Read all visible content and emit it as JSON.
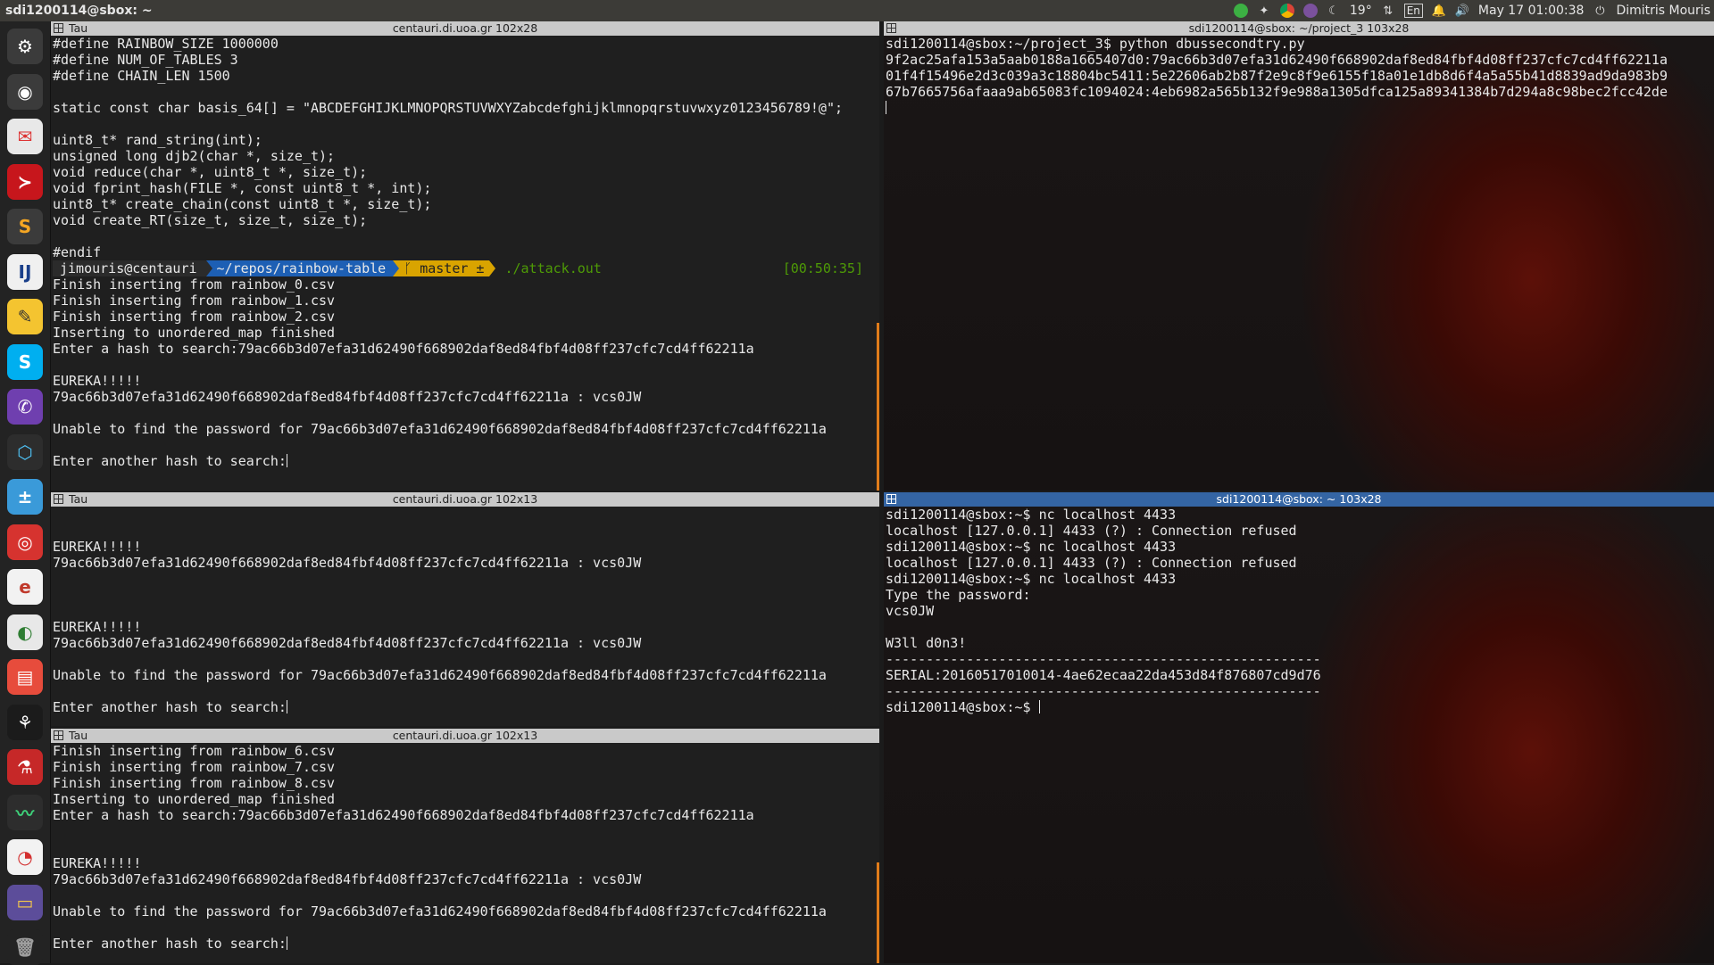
{
  "topbar": {
    "window_title": "sdi1200114@sbox: ~",
    "temperature": "19°",
    "keyboard_layout": "En",
    "datetime": "May 17 01:00:38",
    "user": "Dimitris Mouris"
  },
  "terminals": {
    "tl": {
      "app": "Tau",
      "title": "centauri.di.uoa.gr 102x28",
      "lines_top": [
        "#define RAINBOW_SIZE 1000000",
        "#define NUM_OF_TABLES 3",
        "#define CHAIN_LEN 1500",
        "",
        "static const char basis_64[] = \"ABCDEFGHIJKLMNOPQRSTUVWXYZabcdefghijklmnopqrstuvwxyz0123456789!@\";",
        "",
        "uint8_t* rand_string(int);",
        "unsigned long djb2(char *, size_t);",
        "void reduce(char *, uint8_t *, size_t);",
        "void fprint_hash(FILE *, const uint8_t *, int);",
        "uint8_t* create_chain(const uint8_t *, size_t);",
        "void create_RT(size_t, size_t, size_t);",
        "",
        "#endif"
      ],
      "prompt": {
        "user": "jimouris@centauri",
        "path": "~/repos/rainbow-table",
        "git": "ᚴ master ±",
        "command": "./attack.out",
        "time": "[00:50:35]"
      },
      "lines_bottom": [
        "Finish inserting from rainbow_0.csv",
        "Finish inserting from rainbow_1.csv",
        "Finish inserting from rainbow_2.csv",
        "Inserting to unordered_map finished",
        "Enter a hash to search:79ac66b3d07efa31d62490f668902daf8ed84fbf4d08ff237cfc7cd4ff62211a",
        "",
        "EUREKA!!!!!",
        "79ac66b3d07efa31d62490f668902daf8ed84fbf4d08ff237cfc7cd4ff62211a : vcs0JW",
        "",
        "Unable to find the password for 79ac66b3d07efa31d62490f668902daf8ed84fbf4d08ff237cfc7cd4ff62211a",
        "",
        "Enter another hash to search:"
      ]
    },
    "ml": {
      "app": "Tau",
      "title": "centauri.di.uoa.gr 102x13",
      "lines": [
        "",
        "",
        "EUREKA!!!!!",
        "79ac66b3d07efa31d62490f668902daf8ed84fbf4d08ff237cfc7cd4ff62211a : vcs0JW",
        "",
        "",
        "",
        "EUREKA!!!!!",
        "79ac66b3d07efa31d62490f668902daf8ed84fbf4d08ff237cfc7cd4ff62211a : vcs0JW",
        "",
        "Unable to find the password for 79ac66b3d07efa31d62490f668902daf8ed84fbf4d08ff237cfc7cd4ff62211a",
        "",
        "Enter another hash to search:"
      ]
    },
    "bl": {
      "app": "Tau",
      "title": "centauri.di.uoa.gr 102x13",
      "lines": [
        "Finish inserting from rainbow_6.csv",
        "Finish inserting from rainbow_7.csv",
        "Finish inserting from rainbow_8.csv",
        "Inserting to unordered_map finished",
        "Enter a hash to search:79ac66b3d07efa31d62490f668902daf8ed84fbf4d08ff237cfc7cd4ff62211a",
        "",
        "",
        "EUREKA!!!!!",
        "79ac66b3d07efa31d62490f668902daf8ed84fbf4d08ff237cfc7cd4ff62211a : vcs0JW",
        "",
        "Unable to find the password for 79ac66b3d07efa31d62490f668902daf8ed84fbf4d08ff237cfc7cd4ff62211a",
        "",
        "Enter another hash to search:"
      ]
    },
    "tr": {
      "title": "sdi1200114@sbox: ~/project_3 103x28",
      "lines": [
        "sdi1200114@sbox:~/project_3$ python dbussecondtry.py",
        "9f2ac25afa153a5aab0188a1665407d0:79ac66b3d07efa31d62490f668902daf8ed84fbf4d08ff237cfc7cd4ff62211a",
        "01f4f15496e2d3c039a3c18804bc5411:5e22606ab2b87f2e9c8f9e6155f18a01e1db8d6f4a5a55b41d8839ad9da983b9",
        "67b7665756afaaa9ab65083fc1094024:4eb6982a565b132f9e988a1305dfca125a89341384b7d294a8c98bec2fcc42de",
        ""
      ]
    },
    "br": {
      "title": "sdi1200114@sbox: ~ 103x28",
      "lines": [
        "sdi1200114@sbox:~$ nc localhost 4433",
        "localhost [127.0.0.1] 4433 (?) : Connection refused",
        "sdi1200114@sbox:~$ nc localhost 4433",
        "localhost [127.0.0.1] 4433 (?) : Connection refused",
        "sdi1200114@sbox:~$ nc localhost 4433",
        "Type the password:",
        "vcs0JW",
        "",
        "W3ll d0n3!",
        "------------------------------------------------------",
        "SERIAL:20160517010014-4ae62ecaa22da453d84f876807cd9d76",
        "------------------------------------------------------",
        "sdi1200114@sbox:~$ "
      ]
    }
  },
  "launcher": {
    "items": [
      {
        "name": "ubuntu-dash-icon",
        "color": "#3b3b3b",
        "fg": "#ffffff",
        "glyph": "⚙"
      },
      {
        "name": "chrome-icon",
        "color": "#3b3b3b",
        "fg": "#ffffff",
        "glyph": "◉"
      },
      {
        "name": "mail-icon",
        "color": "#e8e8e8",
        "fg": "#d33",
        "glyph": "✉"
      },
      {
        "name": "terminal-icon",
        "color": "#c7161c",
        "fg": "#ffffff",
        "glyph": "≻"
      },
      {
        "name": "sublime-icon",
        "color": "#3b3b3b",
        "fg": "#f5a623",
        "glyph": "S"
      },
      {
        "name": "intellij-icon",
        "color": "#f0f0f0",
        "fg": "#1a3f8a",
        "glyph": "IJ"
      },
      {
        "name": "lua-icon",
        "color": "#f4c430",
        "fg": "#333",
        "glyph": "✎"
      },
      {
        "name": "skype-icon",
        "color": "#00aff0",
        "fg": "#ffffff",
        "glyph": "S"
      },
      {
        "name": "viber-icon",
        "color": "#6f3faf",
        "fg": "#ffffff",
        "glyph": "✆"
      },
      {
        "name": "network-icon",
        "color": "#2d2d2d",
        "fg": "#4fc3f7",
        "glyph": "⬡"
      },
      {
        "name": "calculator-icon",
        "color": "#3a9ad9",
        "fg": "#ffffff",
        "glyph": "±"
      },
      {
        "name": "recorder-icon",
        "color": "#d6332f",
        "fg": "#ffffff",
        "glyph": "◎"
      },
      {
        "name": "editor-icon",
        "color": "#f2f2f2",
        "fg": "#c0392b",
        "glyph": "e"
      },
      {
        "name": "settings-toggle-icon",
        "color": "#e8e8e8",
        "fg": "#2e7d32",
        "glyph": "◐"
      },
      {
        "name": "presentation-icon",
        "color": "#e74c3c",
        "fg": "#ffffff",
        "glyph": "▤"
      },
      {
        "name": "steam-icon",
        "color": "#1b1b1b",
        "fg": "#ffffff",
        "glyph": "⚘"
      },
      {
        "name": "lab-icon",
        "color": "#c62828",
        "fg": "#ffffff",
        "glyph": "⚗"
      },
      {
        "name": "system-monitor-icon",
        "color": "#2d2d2d",
        "fg": "#3ed17a",
        "glyph": "〰"
      },
      {
        "name": "pie-chart-icon",
        "color": "#f2f2f2",
        "fg": "#d32f2f",
        "glyph": "◔"
      },
      {
        "name": "files-icon",
        "color": "#5c4d9a",
        "fg": "#f7c948",
        "glyph": "▭"
      },
      {
        "name": "trash-icon",
        "color": "#232323",
        "fg": "#9e9e9e",
        "glyph": "🗑"
      }
    ]
  }
}
